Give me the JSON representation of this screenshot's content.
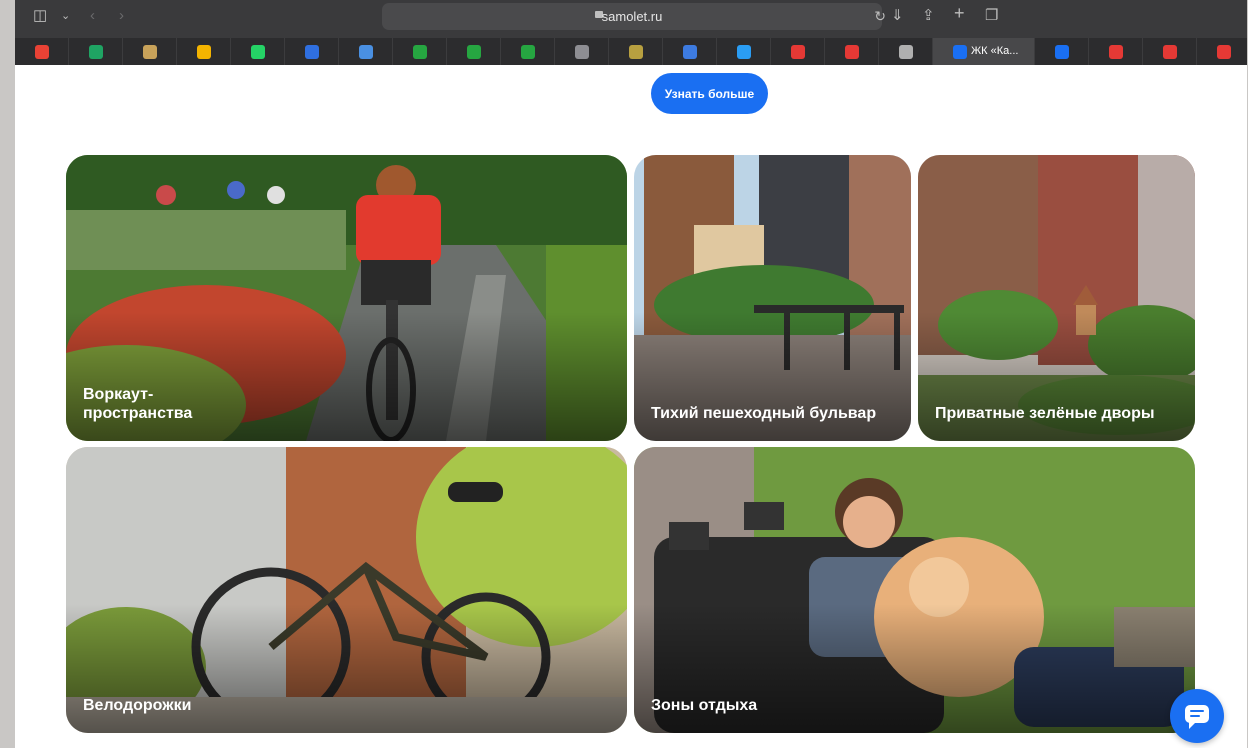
{
  "browser": {
    "address": "samolet.ru",
    "tabs": [
      {
        "icon": "gmail-icon",
        "color": "#e94235"
      },
      {
        "icon": "green-app-icon",
        "color": "#1fa463"
      },
      {
        "icon": "mail-icon",
        "color": "#c8a25a"
      },
      {
        "icon": "squares-icon",
        "color": "#f4b400"
      },
      {
        "icon": "whatsapp-icon",
        "color": "#25d366"
      },
      {
        "icon": "bird-icon",
        "color": "#2f6fe0"
      },
      {
        "icon": "docs-icon",
        "color": "#4a90e2"
      },
      {
        "icon": "green-house-icon",
        "color": "#26a641"
      },
      {
        "icon": "green-house-icon",
        "color": "#26a641"
      },
      {
        "icon": "green-house-icon",
        "color": "#26a641"
      },
      {
        "icon": "f-icon",
        "color": "#8e8e93"
      },
      {
        "icon": "emblem-icon",
        "color": "#b8a040"
      },
      {
        "icon": "chart-icon",
        "color": "#3d7be0"
      },
      {
        "icon": "p-icon",
        "color": "#2a9df4"
      },
      {
        "icon": "red-square-icon",
        "color": "#e53935"
      },
      {
        "icon": "yandex-icon",
        "color": "#e53935"
      },
      {
        "icon": "v-icon",
        "color": "#b0b0b0"
      },
      {
        "icon": "arrow-icon",
        "color": "#1a6ff2",
        "label": "ЖК «Ка...",
        "active": true
      },
      {
        "icon": "arrow-icon",
        "color": "#1a6ff2"
      },
      {
        "icon": "yandex-icon",
        "color": "#e53935"
      },
      {
        "icon": "heart-icon",
        "color": "#e53935"
      },
      {
        "icon": "yandex-icon",
        "color": "#e53935"
      },
      {
        "icon": "telegram-icon",
        "color": "#2aa3e0"
      }
    ]
  },
  "main": {
    "more_button": "Узнать больше",
    "cards": [
      {
        "label": "Воркаут-пространства"
      },
      {
        "label": "Тихий пешеходный бульвар"
      },
      {
        "label": "Приватные зелёные дворы"
      },
      {
        "label": "Велодорожки"
      },
      {
        "label": "Зоны отдыха"
      }
    ]
  },
  "colors": {
    "accent": "#1a6ff2"
  }
}
